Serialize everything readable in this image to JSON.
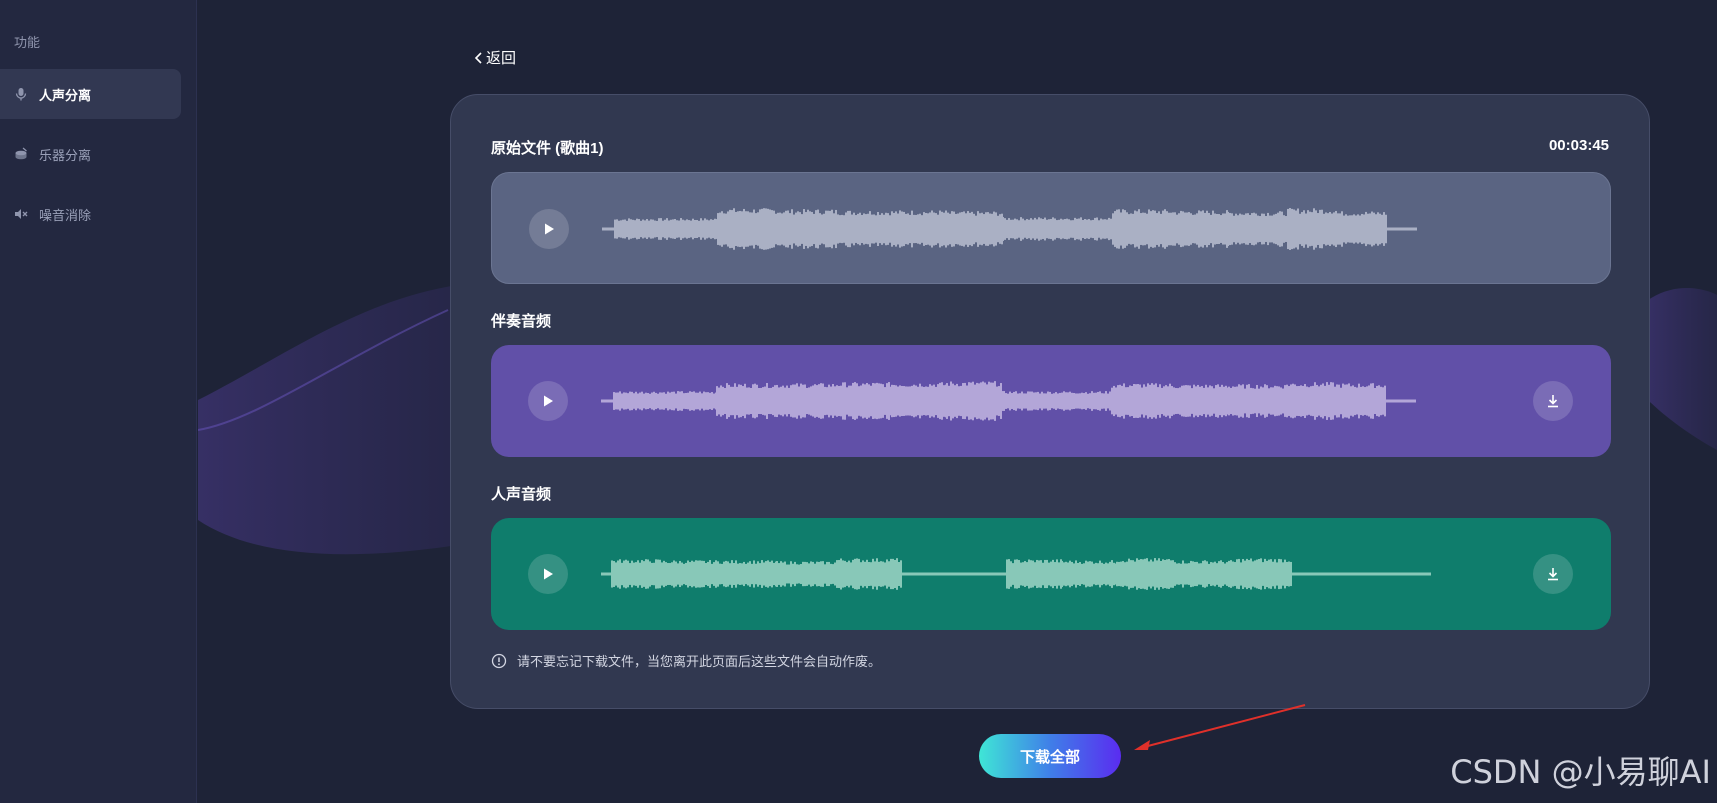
{
  "sidebar": {
    "section_label": "功能",
    "items": [
      {
        "label": "人声分离",
        "icon": "microphone-icon",
        "active": true
      },
      {
        "label": "乐器分离",
        "icon": "drum-icon",
        "active": false
      },
      {
        "label": "噪音消除",
        "icon": "noise-icon",
        "active": false
      }
    ]
  },
  "header": {
    "back_label": "返回"
  },
  "tracks": {
    "original": {
      "title": "原始文件 (歌曲1)",
      "duration": "00:03:45",
      "color": "#5a6482"
    },
    "accompaniment": {
      "title": "伴奏音频",
      "color": "#6150a8"
    },
    "vocals": {
      "title": "人声音频",
      "color": "#0f7d6c"
    }
  },
  "notice": {
    "text": "请不要忘记下载文件，当您离开此页面后这些文件会自动作废。"
  },
  "actions": {
    "download_all_label": "下载全部"
  },
  "watermark": "CSDN @小易聊AI",
  "colors": {
    "background": "#1e2337",
    "sidebar": "#232840",
    "card": "#313850",
    "accent_gradient_start": "#3fe6d6",
    "accent_gradient_end": "#5a2cf0",
    "annotation_arrow": "#e0302a"
  }
}
